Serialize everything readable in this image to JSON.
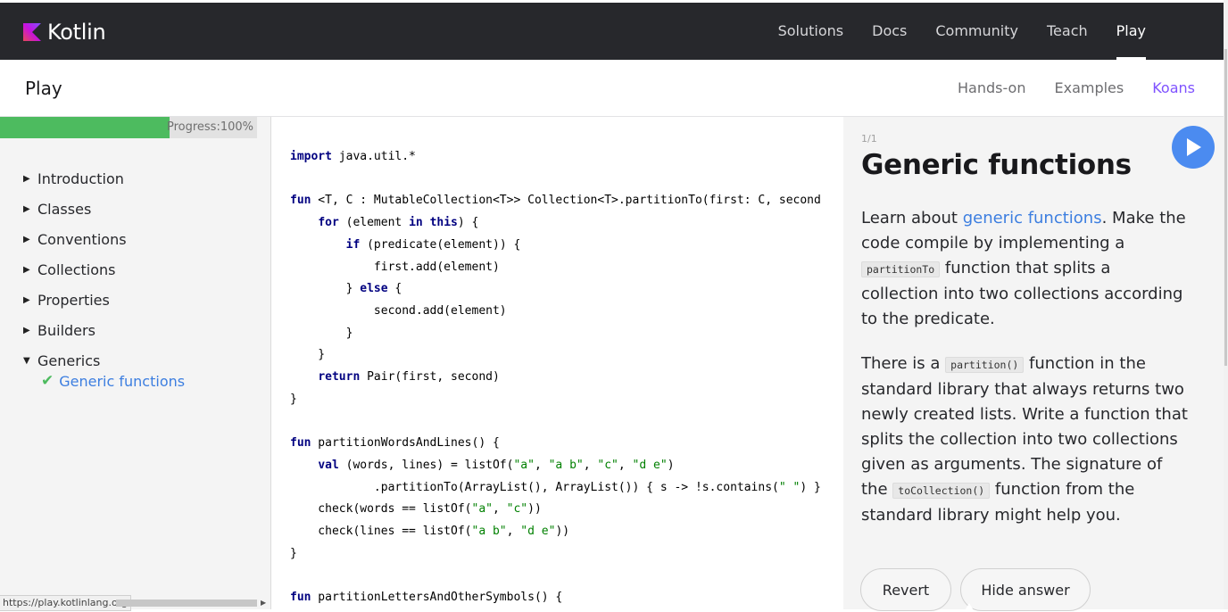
{
  "topbar": {
    "brand": "Kotlin",
    "nav": [
      {
        "label": "Solutions",
        "active": false
      },
      {
        "label": "Docs",
        "active": false
      },
      {
        "label": "Community",
        "active": false
      },
      {
        "label": "Teach",
        "active": false
      },
      {
        "label": "Play",
        "active": true
      }
    ]
  },
  "subbar": {
    "title": "Play",
    "nav": [
      {
        "label": "Hands-on",
        "active": false
      },
      {
        "label": "Examples",
        "active": false
      },
      {
        "label": "Koans",
        "active": true
      }
    ]
  },
  "sidebar": {
    "progress_label": "Progress:100%",
    "progress_value": 100,
    "items": [
      {
        "label": "Introduction",
        "expanded": false
      },
      {
        "label": "Classes",
        "expanded": false
      },
      {
        "label": "Conventions",
        "expanded": false
      },
      {
        "label": "Collections",
        "expanded": false
      },
      {
        "label": "Properties",
        "expanded": false
      },
      {
        "label": "Builders",
        "expanded": false
      },
      {
        "label": "Generics",
        "expanded": true
      }
    ],
    "child_item": "Generic functions",
    "status_url": "https://play.kotlinlang.org"
  },
  "code": {
    "lines": [
      "import java.util.*",
      "",
      "fun <T, C : MutableCollection<T>> Collection<T>.partitionTo(first: C, second",
      "    for (element in this) {",
      "        if (predicate(element)) {",
      "            first.add(element)",
      "        } else {",
      "            second.add(element)",
      "        }",
      "    }",
      "    return Pair(first, second)",
      "}",
      "",
      "fun partitionWordsAndLines() {",
      "    val (words, lines) = listOf(\"a\", \"a b\", \"c\", \"d e\")",
      "            .partitionTo(ArrayList(), ArrayList()) { s -> !s.contains(\" \") }",
      "    check(words == listOf(\"a\", \"c\"))",
      "    check(lines == listOf(\"a b\", \"d e\"))",
      "}",
      "",
      "fun partitionLettersAndOtherSymbols() {"
    ]
  },
  "task": {
    "counter": "1/1",
    "title": "Generic functions",
    "p1_a": "Learn about ",
    "p1_link": "generic functions",
    "p1_b": ". Make the code compile by implementing a ",
    "p1_code": "partitionTo",
    "p1_c": " function that splits a collection into two collections according to the predicate.",
    "p2_a": "There is a ",
    "p2_code1": "partition()",
    "p2_b": " function in the standard library that always returns two newly created lists. Write a function that splits the collection into two collections given as arguments. The signature of the ",
    "p2_code2": "toCollection()",
    "p2_c": " function from the standard library might help you.",
    "revert_label": "Revert",
    "hide_answer_label": "Hide answer"
  },
  "colors": {
    "topbar_bg": "#27282c",
    "accent_purple": "#7f52ff",
    "progress_green": "#4dbb5f",
    "link_blue": "#3c7ee0",
    "run_button_blue": "#4b8bf0"
  }
}
